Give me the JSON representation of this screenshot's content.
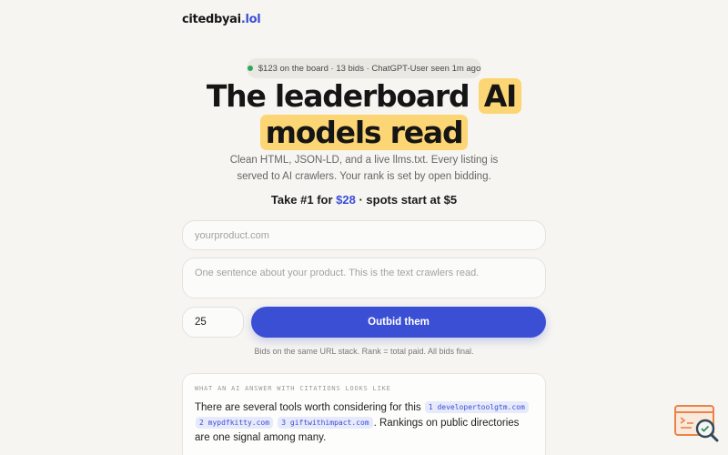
{
  "header": {
    "logo_name": "citedbyai",
    "logo_tld": ".lol"
  },
  "status": {
    "text": "$123 on the board · 13 bids · ChatGPT-User seen 1m ago"
  },
  "hero": {
    "line1_plain": "The leaderboard ",
    "line1_highlight": "AI",
    "line2_highlight": "models read"
  },
  "subtitle": "Clean HTML, JSON-LD, and a live llms.txt. Every listing is served to AI crawlers. Your rank is set by open bidding.",
  "offer": {
    "prefix": "Take #1 for ",
    "price": "$28",
    "suffix": " · spots start at $5"
  },
  "form": {
    "url_placeholder": "yourproduct.com",
    "description_placeholder": "One sentence about your product. This is the text crawlers read.",
    "bid_value": "25",
    "submit_label": "Outbid them",
    "fine_print": "Bids on the same URL stack. Rank = total paid. All bids final."
  },
  "example": {
    "label": "WHAT AN AI ANSWER WITH CITATIONS LOOKS LIKE",
    "intro": "There are several tools worth considering for this ",
    "citations": [
      {
        "label": "1 developertoolgtm.com"
      },
      {
        "label": "2 mypdfkitty.com"
      },
      {
        "label": "3 giftwithimpact.com"
      }
    ],
    "outro": ". Rankings on public directories are one signal among many."
  },
  "colors": {
    "accent": "#3b4fd4",
    "highlight": "#fcd674",
    "status_dot": "#2fa65a",
    "background": "#f6f5f1"
  },
  "icons": {
    "status": "live-dot-icon",
    "corner": "search-code-icon"
  }
}
